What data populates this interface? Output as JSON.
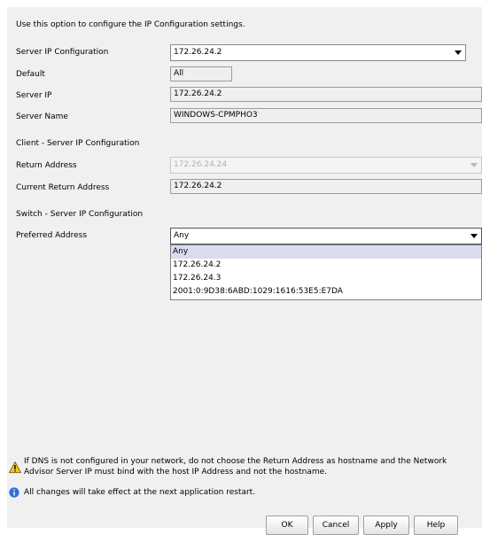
{
  "intro": "Use this option to configure the IP Configuration settings.",
  "server_ip_configuration": {
    "label": "Server IP Configuration",
    "value": "172.26.24.2"
  },
  "default": {
    "label": "Default",
    "value": "All"
  },
  "server_ip": {
    "label": "Server IP",
    "value": "172.26.24.2"
  },
  "server_name": {
    "label": "Server Name",
    "value": "WINDOWS-CPMPHO3"
  },
  "client_section": {
    "title": "Client - Server IP Configuration",
    "return_address": {
      "label": "Return Address",
      "value": "172.26.24.24"
    },
    "current_return_address": {
      "label": "Current Return Address",
      "value": "172.26.24.2"
    }
  },
  "switch_section": {
    "title": "Switch - Server IP Configuration",
    "preferred_address": {
      "label": "Preferred Address",
      "value": "Any",
      "options": [
        "Any",
        "172.26.24.2",
        "172.26.24.3",
        "2001:0:9D38:6ABD:1029:1616:53E5:E7DA"
      ]
    }
  },
  "notes": {
    "warning_line1": "If DNS is not configured in your network, do not choose the Return Address as hostname and the Network",
    "warning_line2": "Advisor Server IP must bind with the host IP Address and not the hostname.",
    "info": "All changes will take effect at the next application restart."
  },
  "buttons": {
    "ok": "OK",
    "cancel": "Cancel",
    "apply": "Apply",
    "help": "Help"
  },
  "icons": {
    "warning": "warning-icon",
    "info": "info-icon",
    "dropdown": "chevron-down-icon"
  },
  "colors": {
    "panel": "#f0f0f0",
    "selected_option": "#dadaf0",
    "info_icon": "#2f6fd6",
    "warning_icon": "#f3c623"
  }
}
